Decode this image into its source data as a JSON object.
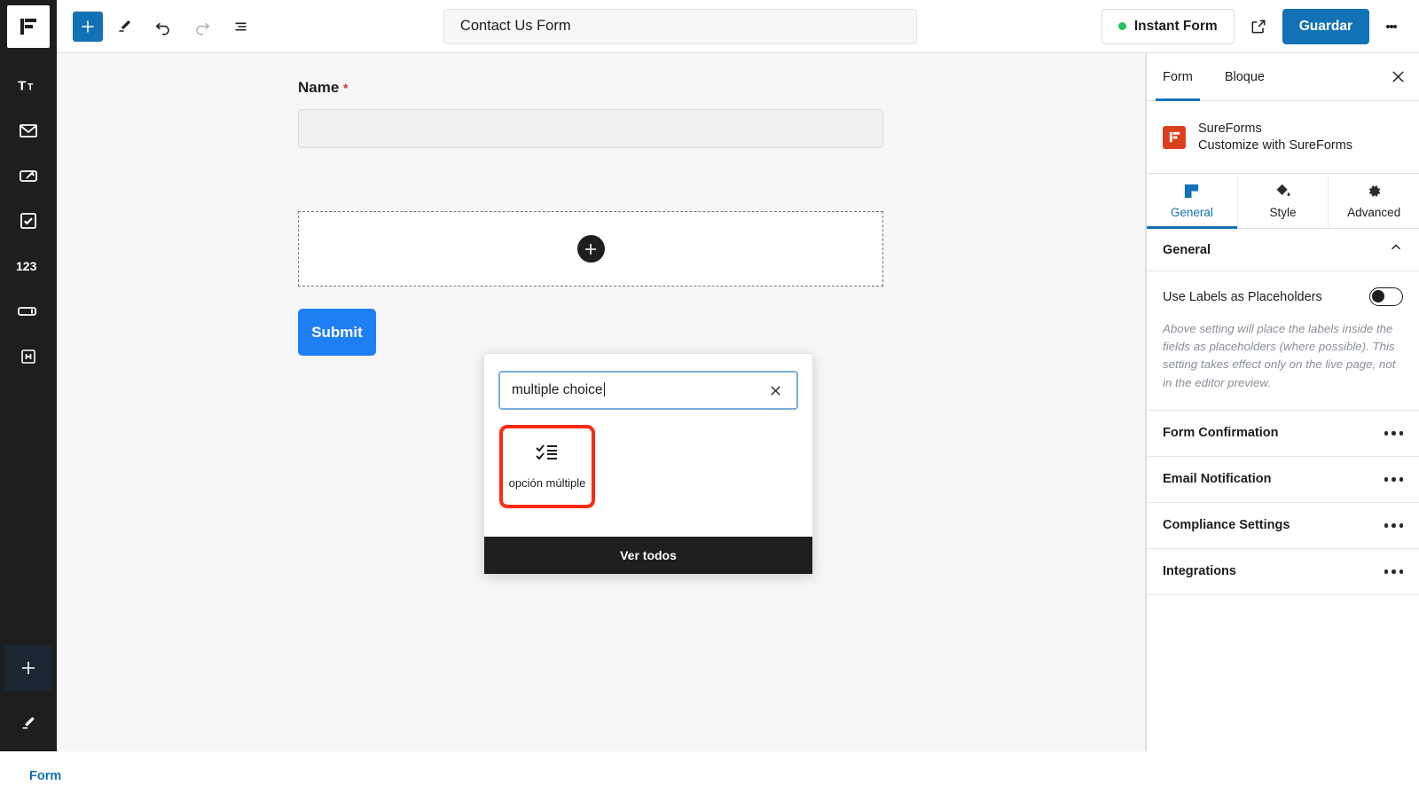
{
  "rail": {
    "logo_icon": "sureforms-logo-icon",
    "items": [
      {
        "icon": "text-size-icon",
        "name": "rail-item-text"
      },
      {
        "icon": "envelope-icon",
        "name": "rail-item-email"
      },
      {
        "icon": "textarea-icon",
        "name": "rail-item-textarea"
      },
      {
        "icon": "checkbox-icon",
        "name": "rail-item-checkbox"
      },
      {
        "icon": "number-123-icon",
        "name": "rail-item-number"
      },
      {
        "icon": "input-field-icon",
        "name": "rail-item-input"
      },
      {
        "icon": "heading-h-icon",
        "name": "rail-item-heading"
      }
    ],
    "add_icon": "plus-icon",
    "edit_icon": "pencil-icon"
  },
  "toolbar": {
    "add_block_icon": "plus-icon",
    "tools_icon": "pencil-icon",
    "undo_icon": "undo-arrow-icon",
    "redo_icon": "redo-arrow-icon",
    "list_view_icon": "document-overview-icon",
    "title": "Contact Us Form",
    "instant_form_label": "Instant Form",
    "instant_form_status_color": "#22c55e",
    "preview_icon": "external-link-icon",
    "save_label": "Guardar",
    "options_icon": "kebab-menu-icon"
  },
  "canvas": {
    "field": {
      "label": "Name",
      "required_marker": "*",
      "value": ""
    },
    "dropzone": {
      "add_icon": "plus-icon"
    },
    "submit_label": "Submit"
  },
  "inserter": {
    "search_value": "multiple choice",
    "clear_icon": "close-x-icon",
    "results": [
      {
        "label": "opción múltiple",
        "icon": "checklist-icon",
        "highlighted": true
      }
    ],
    "browse_all_label": "Ver todos",
    "highlight_color": "#fa2a12"
  },
  "sidebar": {
    "tabs": [
      {
        "label": "Form",
        "active": true
      },
      {
        "label": "Bloque",
        "active": false
      }
    ],
    "close_icon": "close-x-icon",
    "brand": {
      "logo_icon": "sureforms-mark-icon",
      "logo_color": "#d9411e",
      "title": "SureForms",
      "subtitle": "Customize with SureForms"
    },
    "mode_tabs": [
      {
        "label": "General",
        "icon": "general-square-icon",
        "active": true
      },
      {
        "label": "Style",
        "icon": "paint-bucket-icon",
        "active": false
      },
      {
        "label": "Advanced",
        "icon": "gear-icon",
        "active": false
      }
    ],
    "general_panel": {
      "title": "General",
      "collapse_icon": "chevron-up-icon",
      "setting_label": "Use Labels as Placeholders",
      "toggle_on": false,
      "help_text": "Above setting will place the labels inside the fields as placeholders (where possible). This setting takes effect only on the live page, not in the editor preview."
    },
    "accordions": [
      {
        "label": "Form Confirmation",
        "menu_icon": "ellipsis-icon"
      },
      {
        "label": "Email Notification",
        "menu_icon": "ellipsis-icon"
      },
      {
        "label": "Compliance Settings",
        "menu_icon": "ellipsis-icon"
      },
      {
        "label": "Integrations",
        "menu_icon": "ellipsis-icon"
      }
    ]
  },
  "breadcrumb": {
    "items": [
      {
        "label": "Form"
      }
    ]
  },
  "colors": {
    "accent_blue": "#1272b5",
    "submit_blue": "#1e7ff5",
    "dark": "#1e1e1e",
    "brand_orange": "#d9411e",
    "highlight_red": "#fa2a12",
    "status_green": "#22c55e"
  }
}
